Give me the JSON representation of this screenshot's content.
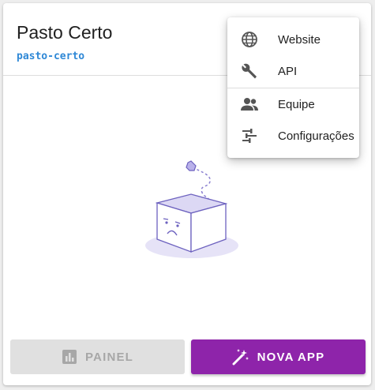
{
  "card": {
    "title": "Pasto Certo",
    "slug": "pasto-certo"
  },
  "actions": {
    "painel_label": "PAINEL",
    "nova_app_label": "NOVA APP"
  },
  "menu": {
    "items": [
      {
        "label": "Website",
        "icon": "globe-icon"
      },
      {
        "label": "API",
        "icon": "wrench-icon"
      },
      {
        "label": "Equipe",
        "icon": "people-icon"
      },
      {
        "label": "Configurações",
        "icon": "tune-icon"
      }
    ]
  },
  "colors": {
    "accent": "#8e24aa",
    "slug": "#2f88d6",
    "disabled_bg": "#e0e0e0"
  }
}
